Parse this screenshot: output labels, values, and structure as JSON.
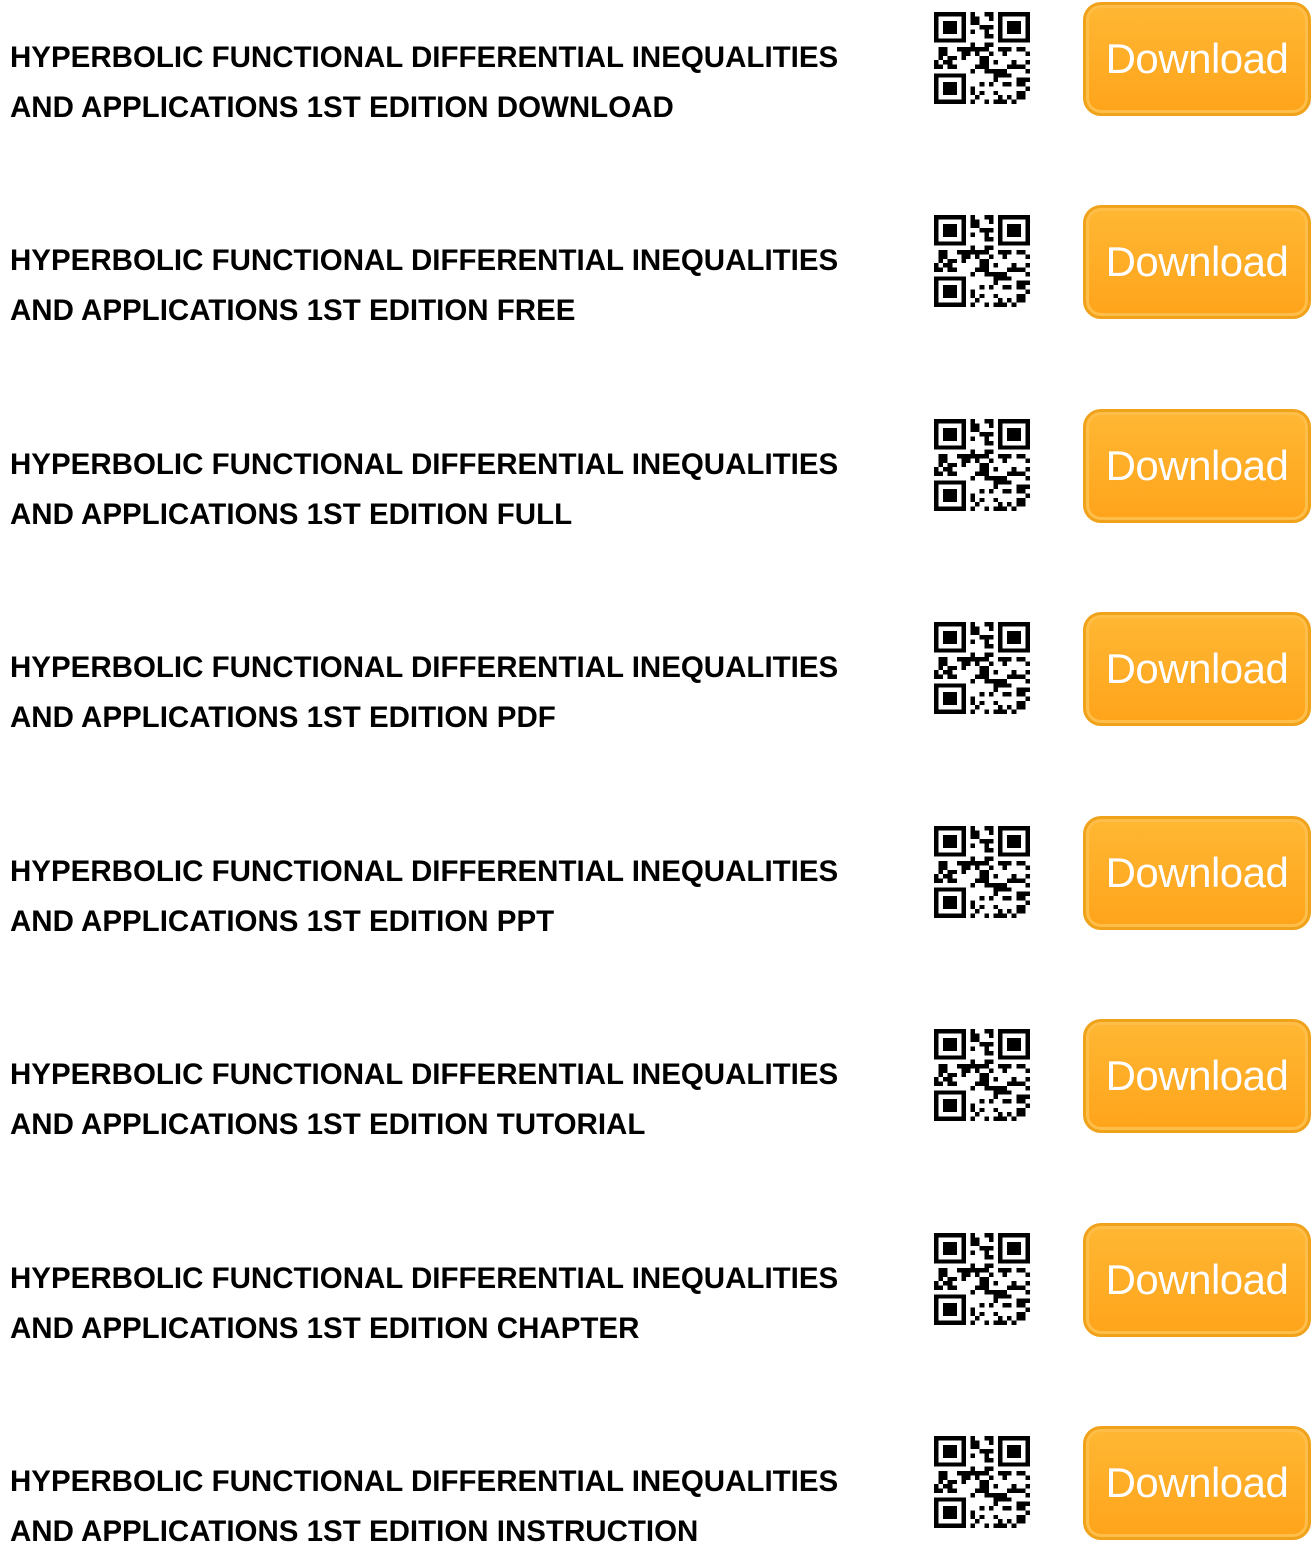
{
  "items": [
    {
      "line1": "HYPERBOLIC FUNCTIONAL DIFFERENTIAL INEQUALITIES",
      "line2": "AND APPLICATIONS 1ST EDITION DOWNLOAD",
      "button": "Download"
    },
    {
      "line1": "HYPERBOLIC FUNCTIONAL DIFFERENTIAL INEQUALITIES",
      "line2": "AND APPLICATIONS 1ST EDITION FREE",
      "button": "Download"
    },
    {
      "line1": "HYPERBOLIC FUNCTIONAL DIFFERENTIAL INEQUALITIES",
      "line2": "AND APPLICATIONS 1ST EDITION FULL",
      "button": "Download"
    },
    {
      "line1": "HYPERBOLIC FUNCTIONAL DIFFERENTIAL INEQUALITIES",
      "line2": "AND APPLICATIONS 1ST EDITION PDF",
      "button": "Download"
    },
    {
      "line1": "HYPERBOLIC FUNCTIONAL DIFFERENTIAL INEQUALITIES",
      "line2": "AND APPLICATIONS 1ST EDITION PPT",
      "button": "Download"
    },
    {
      "line1": "HYPERBOLIC FUNCTIONAL DIFFERENTIAL INEQUALITIES",
      "line2": "AND APPLICATIONS 1ST EDITION TUTORIAL",
      "button": "Download"
    },
    {
      "line1": "HYPERBOLIC FUNCTIONAL DIFFERENTIAL INEQUALITIES",
      "line2": "AND APPLICATIONS 1ST EDITION CHAPTER",
      "button": "Download"
    },
    {
      "line1": "HYPERBOLIC FUNCTIONAL DIFFERENTIAL INEQUALITIES",
      "line2": "AND APPLICATIONS 1ST EDITION INSTRUCTION",
      "button": "Download"
    }
  ],
  "icons": {
    "qr": "qr-code-icon"
  },
  "colors": {
    "button": "#ffa41b",
    "button_text": "#ffffff",
    "title_text": "#000000"
  }
}
